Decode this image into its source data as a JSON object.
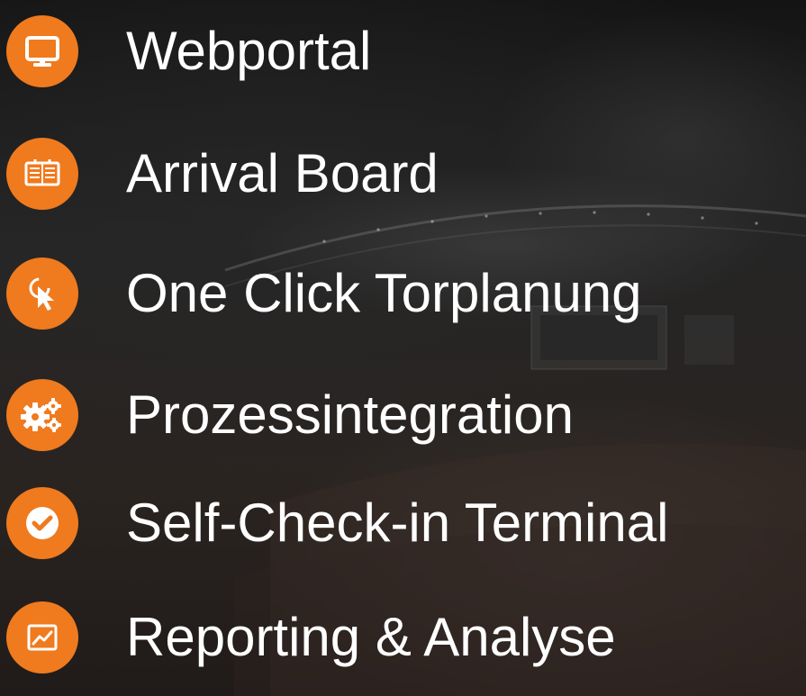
{
  "features": {
    "items": [
      {
        "label": "Webportal",
        "icon": "monitor-icon"
      },
      {
        "label": "Arrival Board",
        "icon": "board-icon"
      },
      {
        "label": "One Click Torplanung",
        "icon": "click-cursor-icon"
      },
      {
        "label": "Prozessintegration",
        "icon": "gears-icon"
      },
      {
        "label": "Self-Check-in Terminal",
        "icon": "checkmark-icon"
      },
      {
        "label": "Reporting & Analyse",
        "icon": "chart-icon"
      }
    ],
    "accent_color": "#f07a1e",
    "text_color": "#ffffff"
  }
}
